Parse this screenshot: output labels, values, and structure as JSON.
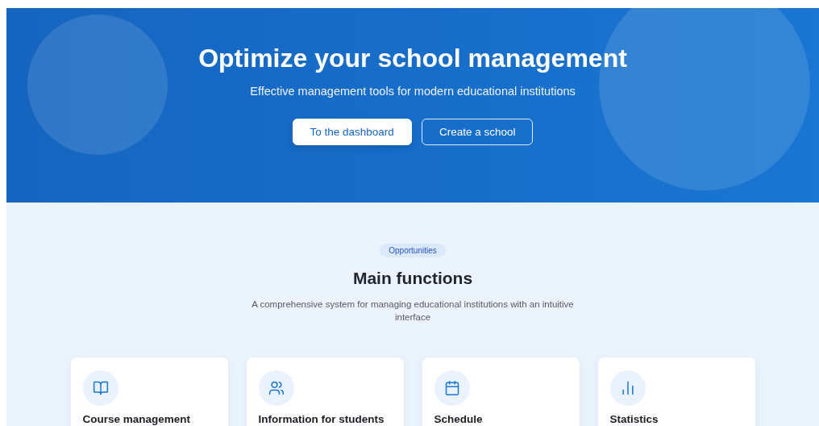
{
  "hero": {
    "title": "Optimize your school management",
    "subtitle": "Effective management tools for modern educational institutions",
    "buttons": [
      {
        "label": "To the dashboard",
        "kind": "primary"
      },
      {
        "label": "Create a school",
        "kind": "outline"
      }
    ]
  },
  "features": {
    "badge": "Opportunities",
    "title": "Main functions",
    "description": "A comprehensive system for managing educational institutions with an intuitive interface",
    "cards": [
      {
        "kind": "book",
        "title": "Course management"
      },
      {
        "kind": "users",
        "title": "Information for students"
      },
      {
        "kind": "calendar",
        "title": "Schedule"
      },
      {
        "kind": "chart",
        "title": "Statistics"
      }
    ]
  }
}
